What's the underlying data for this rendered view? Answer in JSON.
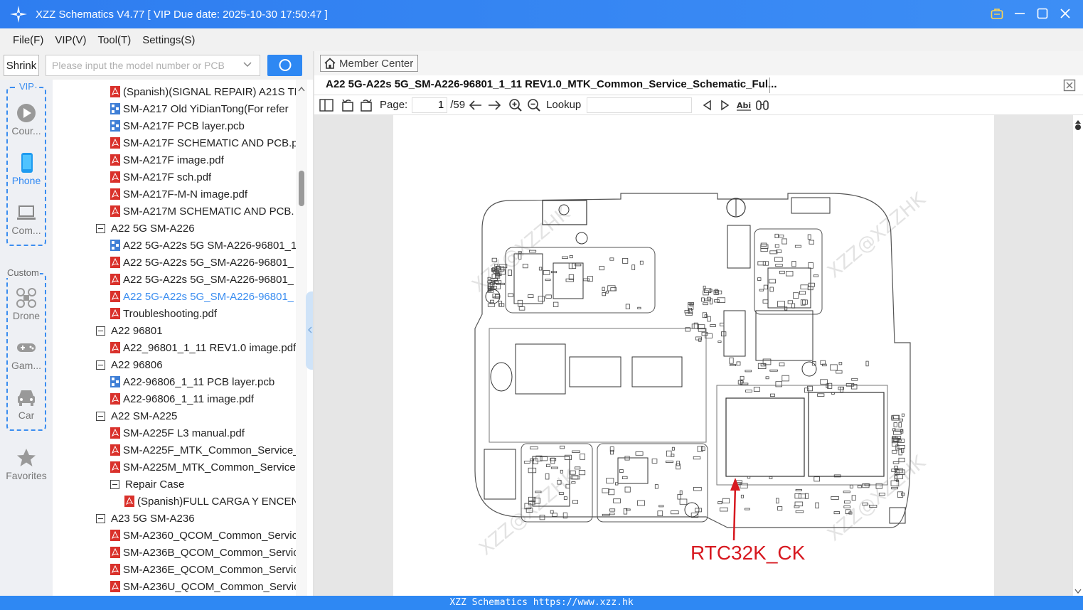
{
  "window": {
    "title": "XZZ Schematics V4.77 [ VIP Due date: 2025-10-30 17:50:47 ]"
  },
  "menu": [
    "File(F)",
    "VIP(V)",
    "Tool(T)",
    "Settings(S)"
  ],
  "toolbar": {
    "shrink_label": "Shrink",
    "search_placeholder": "Please input the model number or PCB"
  },
  "rail": {
    "vip_label": "VIP",
    "custom_label": "Custom",
    "items": [
      {
        "label": "Cour...",
        "icon": "play-circle-icon"
      },
      {
        "label": "Phone",
        "icon": "phone-icon",
        "active": true
      },
      {
        "label": "Com...",
        "icon": "laptop-icon"
      },
      {
        "label": "Drone",
        "icon": "drone-icon"
      },
      {
        "label": "Gam...",
        "icon": "gamepad-icon"
      },
      {
        "label": "Car",
        "icon": "car-icon"
      },
      {
        "label": "Favorites",
        "icon": "star-icon"
      }
    ]
  },
  "tree": [
    {
      "level": 2,
      "type": "pdf",
      "text": "(Spanish)(SIGNAL REPAIR) A21S TE"
    },
    {
      "level": 2,
      "type": "pcb",
      "text": "SM-A217 Old YiDianTong(For refer"
    },
    {
      "level": 2,
      "type": "pcb",
      "text": "SM-A217F PCB layer.pcb"
    },
    {
      "level": 2,
      "type": "pdf",
      "text": "SM-A217F SCHEMATIC AND PCB.p"
    },
    {
      "level": 2,
      "type": "pdf",
      "text": "SM-A217F image.pdf"
    },
    {
      "level": 2,
      "type": "pdf",
      "text": "SM-A217F sch.pdf"
    },
    {
      "level": 2,
      "type": "pdf",
      "text": "SM-A217F-M-N image.pdf"
    },
    {
      "level": 2,
      "type": "pdf",
      "text": "SM-A217M SCHEMATIC AND PCB."
    },
    {
      "level": 1,
      "type": "folder",
      "text": "A22 5G SM-A226"
    },
    {
      "level": 2,
      "type": "pcb",
      "text": "A22 5G-A22s 5G SM-A226-96801_1"
    },
    {
      "level": 2,
      "type": "pdf",
      "text": "A22 5G-A22s 5G_SM-A226-96801_"
    },
    {
      "level": 2,
      "type": "pdf",
      "text": "A22 5G-A22s 5G_SM-A226-96801_"
    },
    {
      "level": 2,
      "type": "pdf",
      "text": "A22 5G-A22s 5G_SM-A226-96801_",
      "selected": true
    },
    {
      "level": 2,
      "type": "pdf",
      "text": "Troubleshooting.pdf"
    },
    {
      "level": 1,
      "type": "folder",
      "text": "A22 96801"
    },
    {
      "level": 2,
      "type": "pdf",
      "text": "A22_96801_1_11 REV1.0 image.pdf"
    },
    {
      "level": 1,
      "type": "folder",
      "text": "A22 96806"
    },
    {
      "level": 2,
      "type": "pcb",
      "text": "A22-96806_1_11 PCB layer.pcb"
    },
    {
      "level": 2,
      "type": "pdf",
      "text": "A22-96806_1_11 image.pdf"
    },
    {
      "level": 1,
      "type": "folder",
      "text": "A22 SM-A225"
    },
    {
      "level": 2,
      "type": "pdf",
      "text": "SM-A225F L3 manual.pdf"
    },
    {
      "level": 2,
      "type": "pdf",
      "text": "SM-A225F_MTK_Common_Service_"
    },
    {
      "level": 2,
      "type": "pdf",
      "text": "SM-A225M_MTK_Common_Service"
    },
    {
      "level": 2,
      "type": "folder",
      "text": "Repair Case"
    },
    {
      "level": 3,
      "type": "pdf",
      "text": "(Spanish)FULL CARGA Y ENCENI"
    },
    {
      "level": 1,
      "type": "folder",
      "text": "A23 5G SM-A236"
    },
    {
      "level": 2,
      "type": "pdf",
      "text": "SM-A2360_QCOM_Common_Servic"
    },
    {
      "level": 2,
      "type": "pdf",
      "text": "SM-A236B_QCOM_Common_Servic"
    },
    {
      "level": 2,
      "type": "pdf",
      "text": "SM-A236E_QCOM_Common_Servic"
    },
    {
      "level": 2,
      "type": "pdf",
      "text": "SM-A236U_QCOM_Common_Servic"
    }
  ],
  "viewer": {
    "member_center": "Member Center",
    "doc_name": "A22 5G-A22s 5G_SM-A226-96801_1_11 REV1.0_MTK_Common_Service_Schematic_Ful...",
    "page_label": "Page:",
    "page_value": "1",
    "page_total": "/59",
    "lookup_label": "Lookup",
    "annotation": "RTC32K_CK",
    "watermark": "XZZ@XZZHK"
  },
  "status": {
    "text": "XZZ Schematics https://www.xzz.hk"
  },
  "colors": {
    "accent": "#2e88f3",
    "selected_text": "#3a8df0",
    "pdf_icon": "#d9312b",
    "annotation": "#d71920"
  }
}
